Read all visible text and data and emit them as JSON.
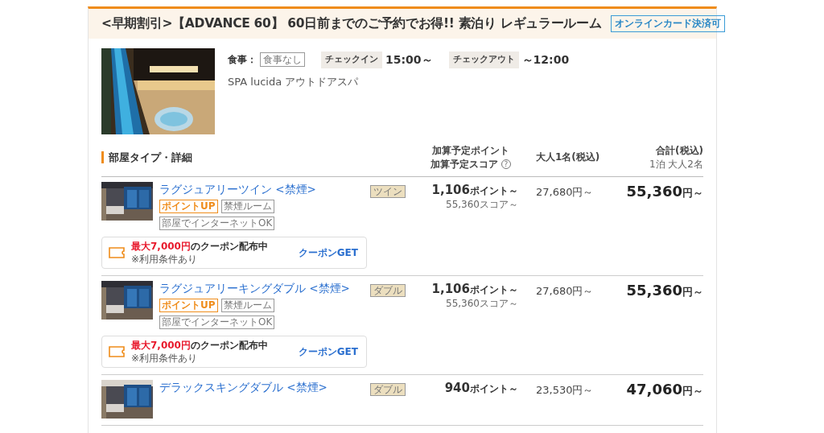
{
  "plan": {
    "title": "<早期割引>【ADVANCE 60】 60日前までのご予約でお得!! 素泊り レギュラールーム",
    "badge": "オンラインカード決済可",
    "meal_label": "食事：",
    "meal_value": "食事なし",
    "checkin_label": "チェックイン",
    "checkin_time": "15:00～",
    "checkout_label": "チェックアウト",
    "checkout_time": "～12:00",
    "description": "SPA lucida アウトドアスパ"
  },
  "columns": {
    "room": "部屋タイプ・詳細",
    "points_line1": "加算予定ポイント",
    "points_line2": "加算予定スコア",
    "help": "?",
    "adult": "大人1名(税込)",
    "total": "合計(税込)",
    "total_sub": "1泊 大人2名"
  },
  "rooms": [
    {
      "name": "ラグジュアリーツイン <禁煙>",
      "tags": [
        {
          "label": "ポイントUP",
          "kind": "highlight"
        },
        {
          "label": "禁煙ルーム",
          "kind": "plain"
        },
        {
          "label": "部屋でインターネットOK",
          "kind": "plain"
        }
      ],
      "type": "ツイン",
      "points": "1,106",
      "points_unit": "ポイント～",
      "score": "55,360スコア～",
      "adult_price": "27,680円～",
      "total": "55,360",
      "total_unit": "円～",
      "coupon": {
        "amount": "最大7,000円",
        "text": "のクーポン配布中",
        "note": "※利用条件あり",
        "action": "クーポンGET"
      }
    },
    {
      "name": "ラグジュアリーキングダブル <禁煙>",
      "tags": [
        {
          "label": "ポイントUP",
          "kind": "highlight"
        },
        {
          "label": "禁煙ルーム",
          "kind": "plain"
        },
        {
          "label": "部屋でインターネットOK",
          "kind": "plain"
        }
      ],
      "type": "ダブル",
      "points": "1,106",
      "points_unit": "ポイント～",
      "score": "55,360スコア～",
      "adult_price": "27,680円～",
      "total": "55,360",
      "total_unit": "円～",
      "coupon": {
        "amount": "最大7,000円",
        "text": "のクーポン配布中",
        "note": "※利用条件あり",
        "action": "クーポンGET"
      }
    },
    {
      "name": "デラックスキングダブル <禁煙>",
      "type": "ダブル",
      "points": "940",
      "points_unit": "ポイント～",
      "adult_price": "23,530円～",
      "total": "47,060",
      "total_unit": "円～"
    }
  ]
}
